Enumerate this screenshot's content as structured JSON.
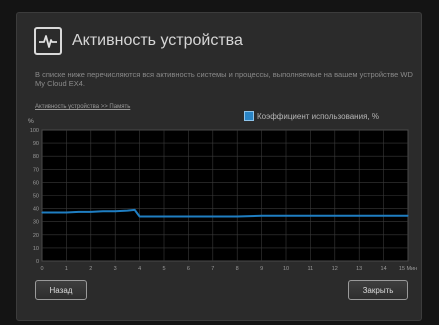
{
  "dialog": {
    "title": "Активность устройства",
    "description": "В списке ниже перечисляются вся активность системы и процессы, выполняемые на вашем устройстве WD My Cloud EX4.",
    "breadcrumb": "Активность устройства >> Память",
    "unit_label": "%",
    "back_label": "Назад",
    "close_label": "Закрыть",
    "icon": "activity-pulse-icon"
  },
  "colors": {
    "series_line": "#1f7ec2",
    "plot_background": "#000000",
    "grid": "#3a3a3a"
  },
  "chart_data": {
    "type": "line",
    "title": "",
    "xlabel": "",
    "ylabel": "%",
    "x_unit": "Мин",
    "xlim": [
      0,
      15
    ],
    "ylim": [
      0,
      100
    ],
    "x_ticks": [
      "0",
      "1",
      "2",
      "3",
      "4",
      "5",
      "6",
      "7",
      "8",
      "9",
      "10",
      "11",
      "12",
      "13",
      "14",
      "15 Мин"
    ],
    "y_ticks": [
      "0",
      "10",
      "20",
      "30",
      "40",
      "50",
      "60",
      "70",
      "80",
      "90",
      "100"
    ],
    "grid": true,
    "legend_position": "top-right",
    "series": [
      {
        "name": "Коэффициент использования, %",
        "x": [
          0,
          0.5,
          1,
          1.5,
          2,
          2.5,
          3,
          3.5,
          3.8,
          4,
          5,
          6,
          7,
          8,
          9,
          10,
          11,
          12,
          13,
          14,
          15
        ],
        "values": [
          37,
          37,
          37,
          37.5,
          37.5,
          38,
          38,
          38.5,
          39,
          34,
          34,
          34,
          34,
          34,
          34.5,
          34.5,
          34.5,
          34.5,
          34.5,
          34.5,
          34.5
        ]
      }
    ]
  }
}
